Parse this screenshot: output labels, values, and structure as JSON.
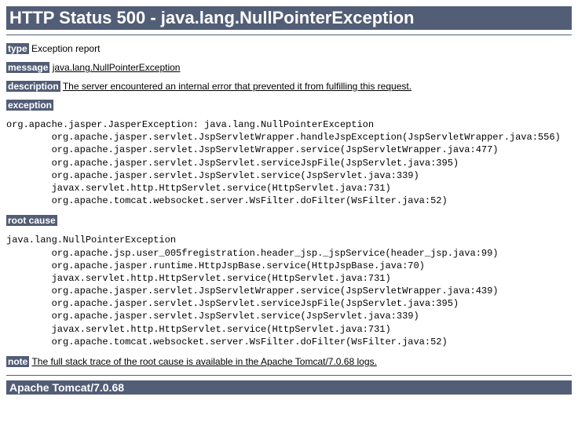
{
  "title": "HTTP Status 500 - java.lang.NullPointerException",
  "labels": {
    "type": "type",
    "message": "message",
    "description": "description",
    "exception": "exception",
    "rootCause": "root cause",
    "note": "note"
  },
  "type": "Exception report",
  "message": "java.lang.NullPointerException",
  "description": "The server encountered an internal error that prevented it from fulfilling this request.",
  "exceptionTrace": "org.apache.jasper.JasperException: java.lang.NullPointerException\n\torg.apache.jasper.servlet.JspServletWrapper.handleJspException(JspServletWrapper.java:556)\n\torg.apache.jasper.servlet.JspServletWrapper.service(JspServletWrapper.java:477)\n\torg.apache.jasper.servlet.JspServlet.serviceJspFile(JspServlet.java:395)\n\torg.apache.jasper.servlet.JspServlet.service(JspServlet.java:339)\n\tjavax.servlet.http.HttpServlet.service(HttpServlet.java:731)\n\torg.apache.tomcat.websocket.server.WsFilter.doFilter(WsFilter.java:52)",
  "rootCauseTrace": "java.lang.NullPointerException\n\torg.apache.jsp.user_005fregistration.header_jsp._jspService(header_jsp.java:99)\n\torg.apache.jasper.runtime.HttpJspBase.service(HttpJspBase.java:70)\n\tjavax.servlet.http.HttpServlet.service(HttpServlet.java:731)\n\torg.apache.jasper.servlet.JspServletWrapper.service(JspServletWrapper.java:439)\n\torg.apache.jasper.servlet.JspServlet.serviceJspFile(JspServlet.java:395)\n\torg.apache.jasper.servlet.JspServlet.service(JspServlet.java:339)\n\tjavax.servlet.http.HttpServlet.service(HttpServlet.java:731)\n\torg.apache.tomcat.websocket.server.WsFilter.doFilter(WsFilter.java:52)",
  "note": "The full stack trace of the root cause is available in the Apache Tomcat/7.0.68 logs.",
  "footer": "Apache Tomcat/7.0.68"
}
